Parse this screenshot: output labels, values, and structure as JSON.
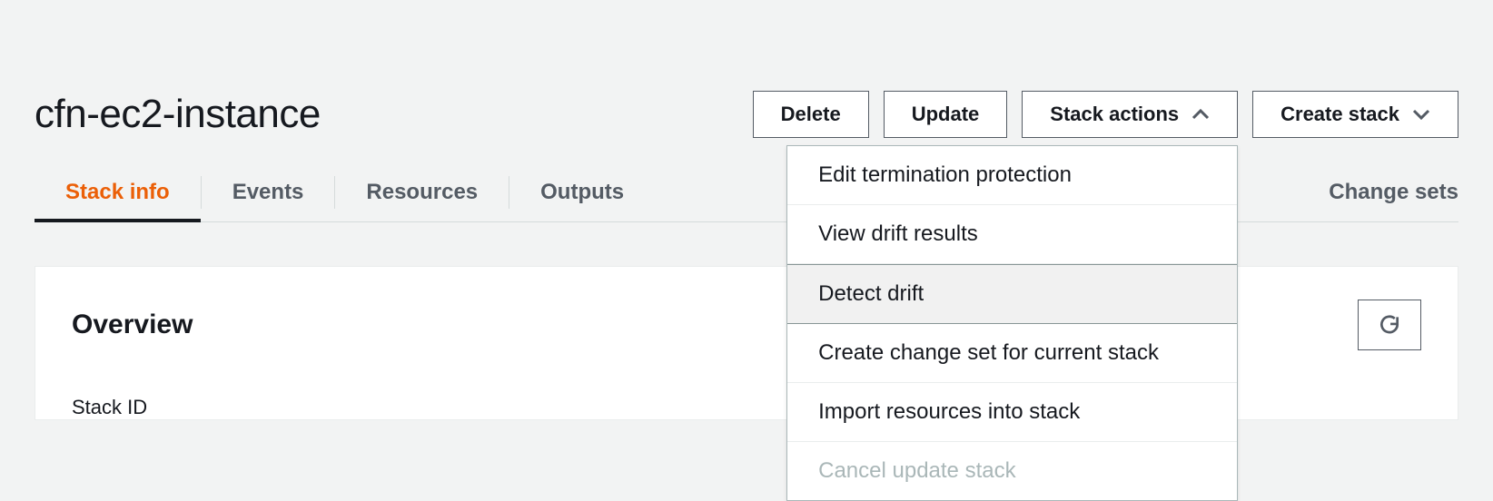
{
  "page": {
    "title": "cfn-ec2-instance"
  },
  "actions": {
    "delete": "Delete",
    "update": "Update",
    "stack_actions": "Stack actions",
    "create_stack": "Create stack"
  },
  "dropdown": {
    "items": [
      {
        "label": "Edit termination protection",
        "highlighted": false,
        "disabled": false
      },
      {
        "label": "View drift results",
        "highlighted": false,
        "disabled": false
      },
      {
        "label": "Detect drift",
        "highlighted": true,
        "disabled": false
      },
      {
        "label": "Create change set for current stack",
        "highlighted": false,
        "disabled": false
      },
      {
        "label": "Import resources into stack",
        "highlighted": false,
        "disabled": false
      },
      {
        "label": "Cancel update stack",
        "highlighted": false,
        "disabled": true
      }
    ]
  },
  "tabs": [
    {
      "label": "Stack info",
      "active": true
    },
    {
      "label": "Events",
      "active": false
    },
    {
      "label": "Resources",
      "active": false
    },
    {
      "label": "Outputs",
      "active": false
    },
    {
      "label": "Change sets",
      "active": false
    }
  ],
  "tabs_gap_right_label": "Change sets",
  "panel": {
    "title": "Overview",
    "field_stack_id": "Stack ID"
  }
}
